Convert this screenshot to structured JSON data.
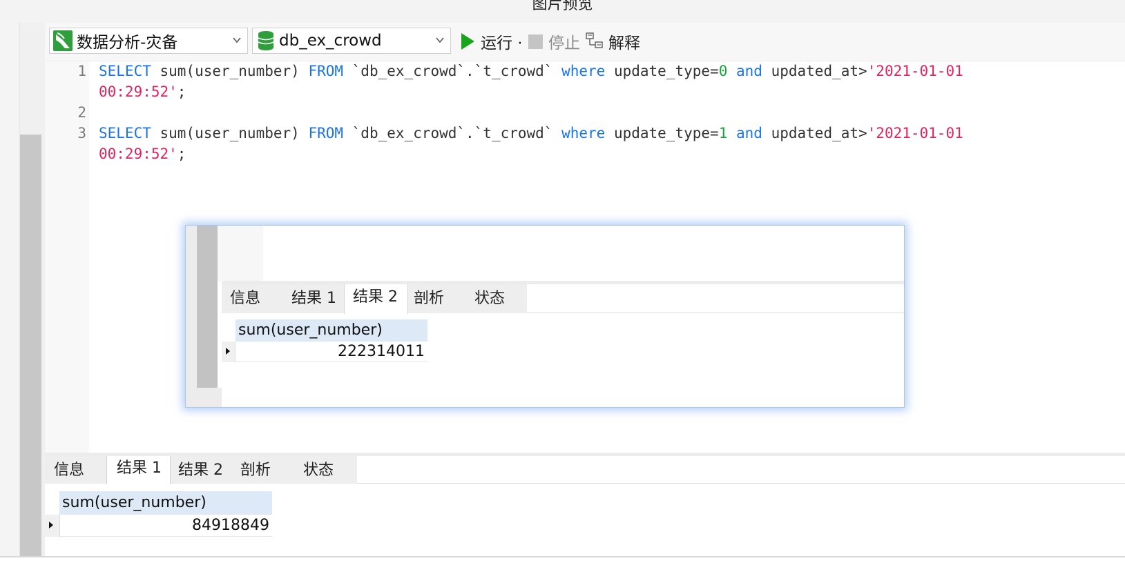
{
  "window": {
    "title": "图片预览"
  },
  "toolbar": {
    "connection": "数据分析-灾备",
    "database": "db_ex_crowd",
    "run_label": "运行 ·",
    "stop_label": "停止",
    "explain_label": "解释"
  },
  "editor": {
    "line_numbers": [
      "1",
      "2",
      "3"
    ],
    "lines": [
      {
        "kw1": "SELECT",
        "part1": " sum(user_number) ",
        "kw2": "FROM",
        "part2": " `db_ex_crowd`.`t_crowd` ",
        "kw3": "where",
        "part3": " update_type=",
        "num": "0",
        "part4": " ",
        "kw4": "and",
        "part5": " updated_at>",
        "str1": "'2021-01-01",
        "str2": "00:29:52'",
        "end": ";"
      },
      {
        "kw1": "SELECT",
        "part1": " sum(user_number) ",
        "kw2": "FROM",
        "part2": " `db_ex_crowd`.`t_crowd` ",
        "kw3": "where",
        "part3": " update_type=",
        "num": "1",
        "part4": " ",
        "kw4": "and",
        "part5": " updated_at>",
        "str1": "'2021-01-01",
        "str2": "00:29:52'",
        "end": ";"
      }
    ]
  },
  "preview": {
    "tabs": [
      "信息",
      "结果 1",
      "结果 2",
      "剖析",
      "状态"
    ],
    "active_tab": "结果 2",
    "column_header": "sum(user_number)",
    "value": "222314011"
  },
  "results": {
    "tabs": [
      "信息",
      "结果 1",
      "结果 2",
      "剖析",
      "状态"
    ],
    "active_tab": "结果 1",
    "column_header": "sum(user_number)",
    "value": "84918849"
  },
  "icons": {
    "connection": "mysql-connection-icon",
    "database": "database-icon",
    "run": "play-icon",
    "stop": "stop-icon",
    "explain": "explain-icon"
  },
  "colors": {
    "keyword": "#1a73e8",
    "number": "#18a33a",
    "string": "#e0245e",
    "run_green": "#19a41b",
    "header_blue": "#dde9f7"
  }
}
